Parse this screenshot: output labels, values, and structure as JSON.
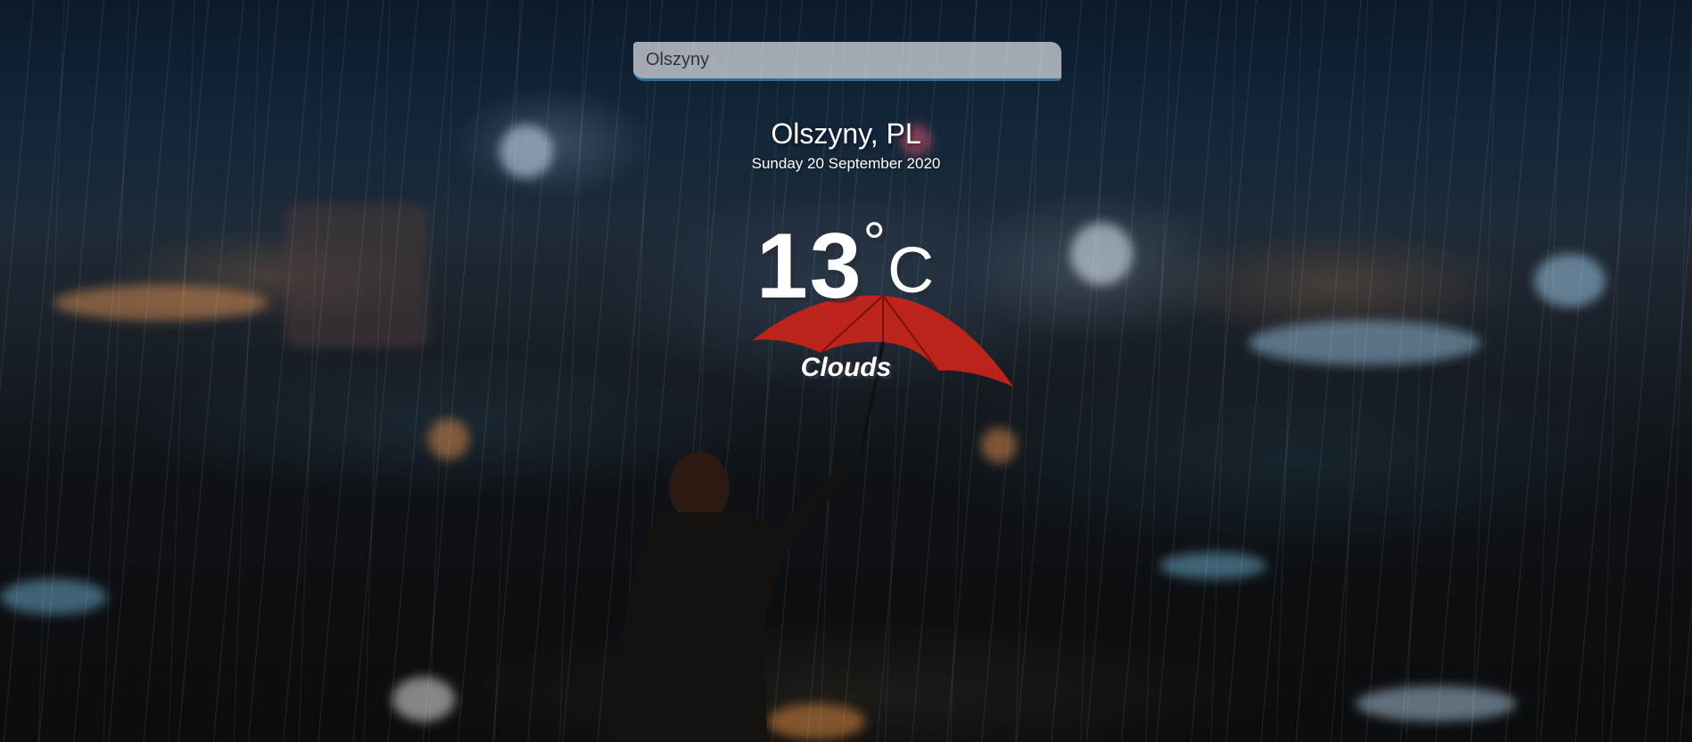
{
  "search": {
    "value": "Olszyny",
    "placeholder": ""
  },
  "location": {
    "name": "Olszyny, PL",
    "date": "Sunday 20 September 2020"
  },
  "weather": {
    "temperature": "13",
    "degree_symbol": "°",
    "unit": "C",
    "condition": "Clouds"
  },
  "background": {
    "accent_color": "#2f6f95",
    "umbrella_color": "#c4241a"
  }
}
